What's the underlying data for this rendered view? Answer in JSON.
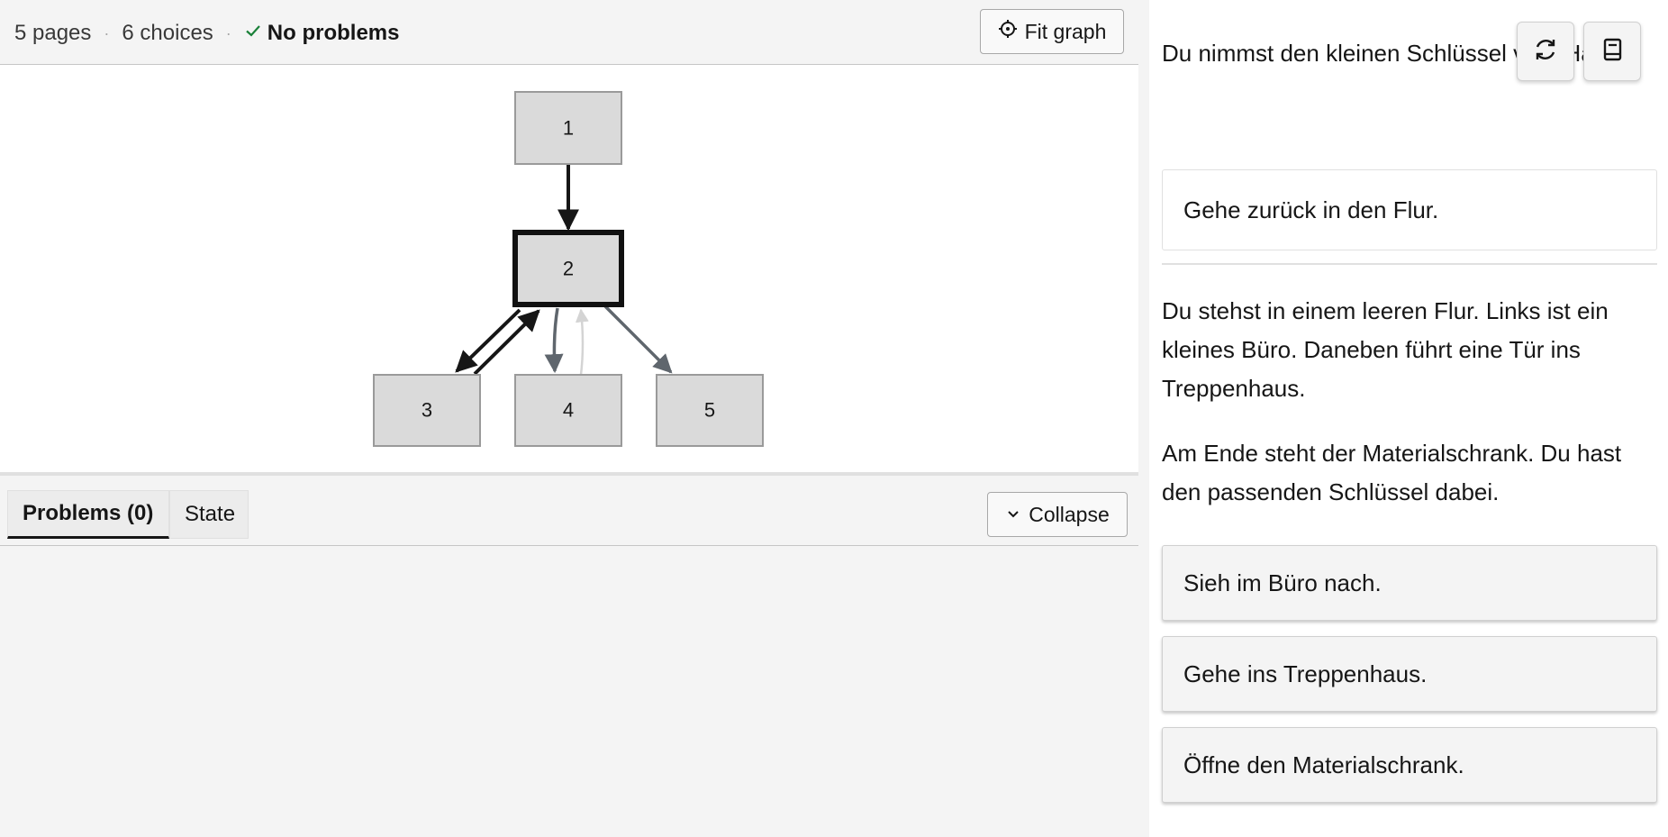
{
  "stats": {
    "pages": "5 pages",
    "choices": "6 choices",
    "status": "No problems",
    "separator": "·"
  },
  "toolbar": {
    "fit_label": "Fit graph"
  },
  "graph": {
    "nodes": [
      {
        "id": "n1",
        "label": "1",
        "current": false
      },
      {
        "id": "n2",
        "label": "2",
        "current": true
      },
      {
        "id": "n3",
        "label": "3",
        "current": false
      },
      {
        "id": "n4",
        "label": "4",
        "current": false
      },
      {
        "id": "n5",
        "label": "5",
        "current": false
      }
    ],
    "edges": [
      {
        "from": "1",
        "to": "2",
        "style": "visited"
      },
      {
        "from": "2",
        "to": "3",
        "style": "visited"
      },
      {
        "from": "3",
        "to": "2",
        "style": "visited"
      },
      {
        "from": "2",
        "to": "4",
        "style": "available"
      },
      {
        "from": "4",
        "to": "2",
        "style": "faded"
      },
      {
        "from": "2",
        "to": "5",
        "style": "available"
      }
    ],
    "colors": {
      "visited": "#161616",
      "available": "#5f666d",
      "faded": "#d4d4d4"
    }
  },
  "panel": {
    "tabs": [
      {
        "label": "Problems (0)",
        "selected": true
      },
      {
        "label": "State",
        "selected": false
      }
    ],
    "collapse_label": "Collapse"
  },
  "story": {
    "prev_text": "Du nimmst den kleinen Schlüssel vom Haken.",
    "chosen": "Gehe zurück in den Flur.",
    "paragraphs": [
      "Du stehst in einem leeren Flur. Links ist ein kleines Büro. Daneben führt eine Tür ins Treppenhaus.",
      "Am Ende steht der Materialschrank. Du hast den passenden Schlüssel dabei."
    ],
    "choices": [
      "Sieh im Büro nach.",
      "Gehe ins Treppenhaus.",
      "Öffne den Materialschrank."
    ]
  },
  "icons": {
    "fit": "crosshair-icon",
    "collapse": "chevron-down-icon",
    "restart": "refresh-icon",
    "book": "book-icon",
    "check": "checkmark-icon"
  }
}
